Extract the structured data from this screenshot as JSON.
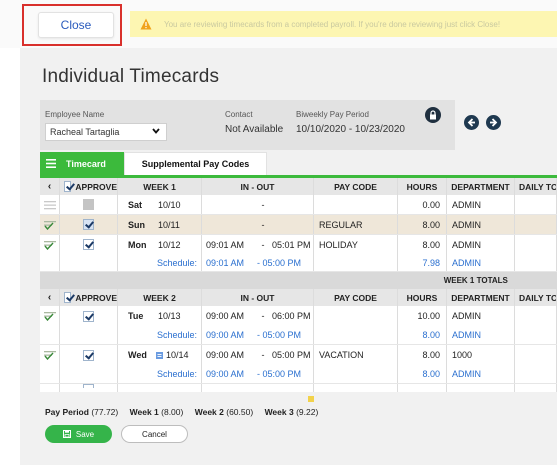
{
  "topbar": {
    "close_label": "Close",
    "banner_text": "You are reviewing timecards from a completed payroll. If you're done reviewing just click Close!"
  },
  "page": {
    "title": "Individual Timecards"
  },
  "filters": {
    "employee_label": "Employee Name",
    "employee_value": "Racheal Tartaglia",
    "contact_label": "Contact",
    "contact_value": "Not Available",
    "period_label": "Biweekly Pay Period",
    "period_value": "10/10/2020 - 10/23/2020"
  },
  "tabs": {
    "timecard": "Timecard",
    "supplemental": "Supplemental Pay Codes"
  },
  "table": {
    "week1_header": {
      "approve": "APPROVE",
      "week": "WEEK 1",
      "inout": "IN - OUT",
      "paycode": "PAY CODE",
      "hours": "HOURS",
      "department": "DEPARTMENT",
      "daily": "DAILY TO"
    },
    "week1_rows": [
      {
        "day": "Sat",
        "date": "10/10",
        "in": "",
        "dash": "-",
        "out": "",
        "paycode": "",
        "hours": "0.00",
        "department": "ADMIN"
      },
      {
        "day": "Sun",
        "date": "10/11",
        "in": "",
        "dash": "-",
        "out": "",
        "paycode": "REGULAR",
        "hours": "8.00",
        "department": "ADMIN"
      },
      {
        "day": "Mon",
        "date": "10/12",
        "in": "09:01 AM",
        "dash": "-",
        "out": "05:01 PM",
        "paycode": "HOLIDAY",
        "hours": "8.00",
        "department": "ADMIN"
      }
    ],
    "week1_schedule": {
      "label": "Schedule:",
      "in": "09:01 AM",
      "out": "- 05:00 PM",
      "hours": "7.98",
      "department": "ADMIN"
    },
    "week1_totals_label": "WEEK 1 TOTALS",
    "week2_header": {
      "approve": "APPROVE",
      "week": "WEEK 2",
      "inout": "IN - OUT",
      "paycode": "PAY CODE",
      "hours": "HOURS",
      "department": "DEPARTMENT",
      "daily": "DAILY TO"
    },
    "week2_rows": [
      {
        "day": "Tue",
        "date": "10/13",
        "in": "09:00 AM",
        "dash": "-",
        "out": "06:00 PM",
        "paycode": "",
        "hours": "10.00",
        "department": "ADMIN",
        "sched_label": "Schedule:",
        "sched_in": "09:00 AM",
        "sched_out": "- 05:00 PM",
        "sched_hours": "8.00",
        "sched_department": "ADMIN"
      },
      {
        "day": "Wed",
        "date": "10/14",
        "in": "09:00 AM",
        "dash": "-",
        "out": "05:00 PM",
        "paycode": "VACATION",
        "hours": "8.00",
        "department": "1000",
        "sched_label": "Schedule:",
        "sched_in": "09:00 AM",
        "sched_out": "- 05:00 PM",
        "sched_hours": "8.00",
        "sched_department": "ADMIN"
      }
    ]
  },
  "summary": {
    "pay_period_label": "Pay Period",
    "pay_period_value": "(77.72)",
    "week1_label": "Week 1",
    "week1_value": "(8.00)",
    "week2_label": "Week 2",
    "week2_value": "(60.50)",
    "week3_label": "Week 3",
    "week3_value": "(9.22)"
  },
  "actions": {
    "save_label": "Save",
    "cancel_label": "Cancel"
  },
  "colors": {
    "accent_green": "#3cba3c",
    "link_blue": "#2a6fcf",
    "banner_yellow": "#fdf6b2",
    "highlight_red": "#d9302c"
  }
}
